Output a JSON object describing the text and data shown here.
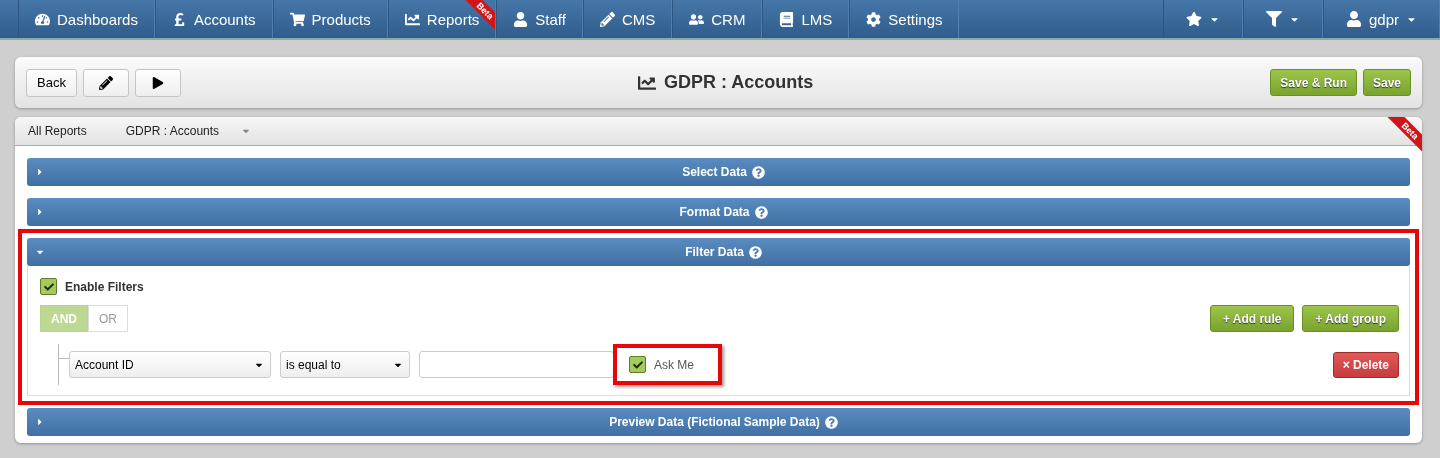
{
  "nav": {
    "items": [
      {
        "label": "Dashboards",
        "selected": false
      },
      {
        "label": "Accounts",
        "selected": false
      },
      {
        "label": "Products",
        "selected": false
      },
      {
        "label": "Reports",
        "selected": false,
        "ribbon": "Beta"
      },
      {
        "label": "Staff",
        "selected": false
      },
      {
        "label": "CMS",
        "selected": false
      },
      {
        "label": "CRM",
        "selected": false
      },
      {
        "label": "LMS",
        "selected": false
      },
      {
        "label": "Settings",
        "selected": false
      }
    ],
    "right": [
      {
        "kind": "star"
      },
      {
        "kind": "filter"
      },
      {
        "kind": "user",
        "label": "gdpr"
      }
    ]
  },
  "toolbar": {
    "back": "Back",
    "title": "GDPR : Accounts",
    "save_run": "Save & Run",
    "save": "Save"
  },
  "breadcrumb": {
    "items": [
      {
        "label": "All Reports"
      },
      {
        "label": "GDPR : Accounts"
      }
    ],
    "ribbon": "Beta"
  },
  "sections": [
    {
      "title": "Select Data",
      "expanded": false,
      "highlighted": false
    },
    {
      "title": "Format Data",
      "expanded": false,
      "highlighted": false
    },
    {
      "title": "Filter Data",
      "expanded": true,
      "highlighted": true
    },
    {
      "title": "Preview Data (Fictional Sample Data)",
      "expanded": false,
      "highlighted": false
    }
  ],
  "filters": {
    "enable": {
      "label": "Enable Filters",
      "checked": true
    },
    "conditions": [
      {
        "label": "AND",
        "selected": true
      },
      {
        "label": "OR",
        "selected": false
      }
    ],
    "add_rule": "+  Add rule",
    "add_group": "+  Add group",
    "rule": {
      "field": "Account ID",
      "operator": "is equal to",
      "ask_me": {
        "label": "Ask Me",
        "checked": true,
        "highlighted": true
      },
      "delete": "× Delete"
    }
  }
}
